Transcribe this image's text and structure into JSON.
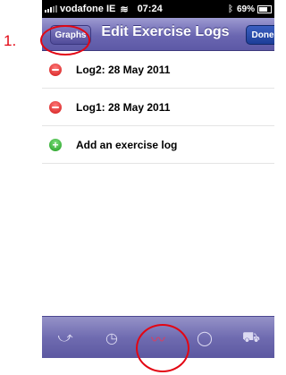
{
  "annotation": {
    "step_number": "1."
  },
  "status_bar": {
    "carrier": "vodafone IE",
    "time": "07:24",
    "battery_percent": "69%"
  },
  "nav_bar": {
    "left_button": "Graphs",
    "title": "Edit Exercise Logs",
    "right_button": "Done"
  },
  "list": {
    "rows": [
      {
        "label": "Log2: 28 May 2011",
        "action": "delete"
      },
      {
        "label": "Log1: 28 May 2011",
        "action": "delete"
      },
      {
        "label": "Add an exercise log",
        "action": "add"
      }
    ]
  },
  "tab_bar": {
    "tabs": [
      {
        "icon": "exercise-icon",
        "glyph": "⤻",
        "active": false
      },
      {
        "icon": "clock-icon",
        "glyph": "◷",
        "active": false
      },
      {
        "icon": "graph-icon",
        "glyph": "〰",
        "active": true
      },
      {
        "icon": "speech-bubble-icon",
        "glyph": "◯",
        "active": false
      },
      {
        "icon": "cart-icon",
        "glyph": "⛟",
        "active": false
      }
    ]
  },
  "colors": {
    "nav_bar": "#6a66b1",
    "done_button": "#1d3e98",
    "annotation": "#e30613",
    "active_tab": "#e23b5a"
  }
}
